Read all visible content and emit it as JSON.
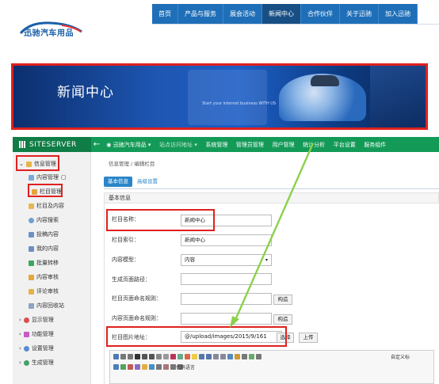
{
  "header": {
    "logo_text": "迅驰汽车用品",
    "nav": [
      "首页",
      "产品与服务",
      "展会活动",
      "新闻中心",
      "合作伙伴",
      "关于迅驰",
      "加入迅驰"
    ],
    "active_nav": "新闻中心"
  },
  "banner": {
    "title": "新闻中心",
    "tagline": "Start your internet business   WITH US"
  },
  "topbar": {
    "brand": "SITESERVER",
    "back": "←",
    "site_selector": "迅驰汽车用品",
    "menu": [
      "站点访问地址",
      "系统管理",
      "管理员管理",
      "用户管理",
      "统计分析",
      "平台设置",
      "服务组件"
    ]
  },
  "sidebar": {
    "items": [
      {
        "label": "信息管理",
        "level": 0,
        "icon": "folder-icon"
      },
      {
        "label": "内容管理",
        "level": 1,
        "icon": "content-icon"
      },
      {
        "label": "栏目管理",
        "level": 1,
        "icon": "column-icon"
      },
      {
        "label": "栏目及内容",
        "level": 1,
        "icon": "column-content-icon"
      },
      {
        "label": "内容搜索",
        "level": 1,
        "icon": "search-icon"
      },
      {
        "label": "投稿内容",
        "level": 1,
        "icon": "submit-icon"
      },
      {
        "label": "我的内容",
        "level": 1,
        "icon": "mine-icon"
      },
      {
        "label": "批量转移",
        "level": 1,
        "icon": "batch-move-icon"
      },
      {
        "label": "内容审核",
        "level": 1,
        "icon": "audit-icon"
      },
      {
        "label": "评论审核",
        "level": 1,
        "icon": "comment-icon"
      },
      {
        "label": "内容回收站",
        "level": 1,
        "icon": "recycle-icon"
      },
      {
        "label": "显示管理",
        "level": 0,
        "icon": "display-icon"
      },
      {
        "label": "功能管理",
        "level": 0,
        "icon": "function-icon"
      },
      {
        "label": "设置管理",
        "level": 0,
        "icon": "settings-icon"
      },
      {
        "label": "生成管理",
        "level": 0,
        "icon": "generate-icon"
      }
    ]
  },
  "breadcrumb": "信息管理 / 编辑栏目",
  "tabs": {
    "basic": "基本信息",
    "advanced": "高级设置"
  },
  "panel_title": "基本信息",
  "form": {
    "name_label": "栏目名称：",
    "name_value": "新闻中心",
    "index_label": "栏目索引：",
    "index_value": "新闻中心",
    "model_label": "内容模型：",
    "model_value": "内容",
    "gen_path_label": "生成页面路径：",
    "column_rule_label": "栏目页面命名规则：",
    "content_rule_label": "内容页面命名规则：",
    "construct_btn": "构造",
    "image_label": "栏目图片地址：",
    "image_value": "@/upload/images/2015/9/161",
    "select_btn": "选择",
    "upload_btn": "上传"
  },
  "editor": {
    "toolbar_labels": [
      "代码语言",
      "自定义标"
    ]
  },
  "colors": {
    "annotation_red": "#e02020",
    "arrow_green": "#8bd14b",
    "topbar_green": "#139a57",
    "nav_blue": "#1f6fb8"
  }
}
